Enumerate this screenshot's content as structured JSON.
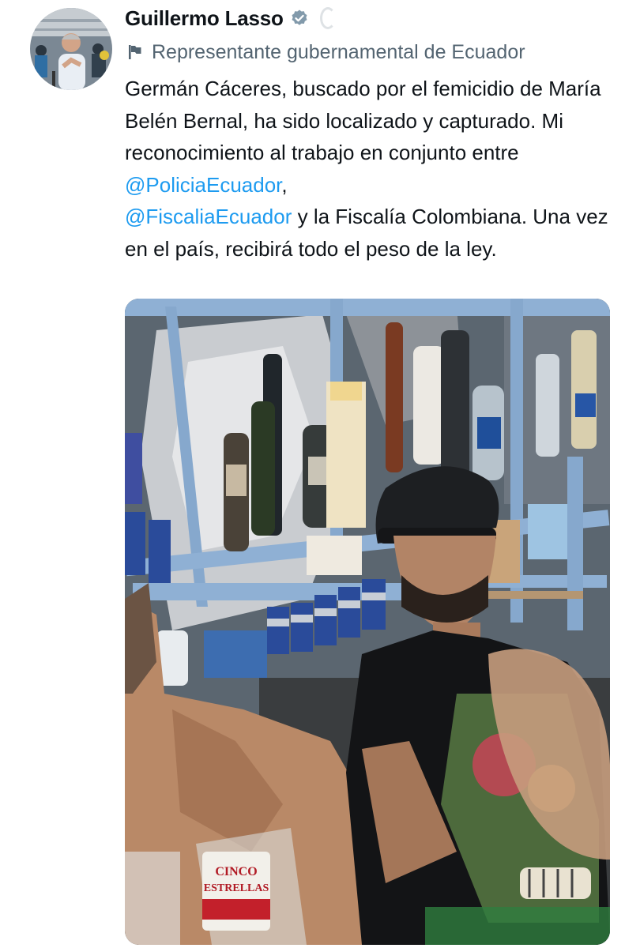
{
  "author": {
    "display_name": "Guillermo Lasso",
    "verified_icon": "verified-badge-icon",
    "label": "Representante gubernamental de Ecuador",
    "label_icon": "flag-icon",
    "avatar_icon": "profile-photo"
  },
  "tweet": {
    "line1_before": "Germán Cáceres, buscado por el femicidio de María Belén Bernal, ha sido localizado y capturado. Mi reconocimiento al trabajo en conjunto entre ",
    "mention1": "@PoliciaEcuador",
    "after_mention1": ",",
    "mention2": "@FiscaliaEcuador",
    "after_mention2": " y la Fiscalía Colombiana. Una vez en el país, recibirá todo el peso de la ley."
  },
  "media": {
    "kind": "photo",
    "cup_label_line1": "CINCO",
    "cup_label_line2": "ESTRELLAS"
  },
  "colors": {
    "accent": "#1d9bf0",
    "secondary_text": "#536471",
    "verified_gray": "#829aab"
  }
}
